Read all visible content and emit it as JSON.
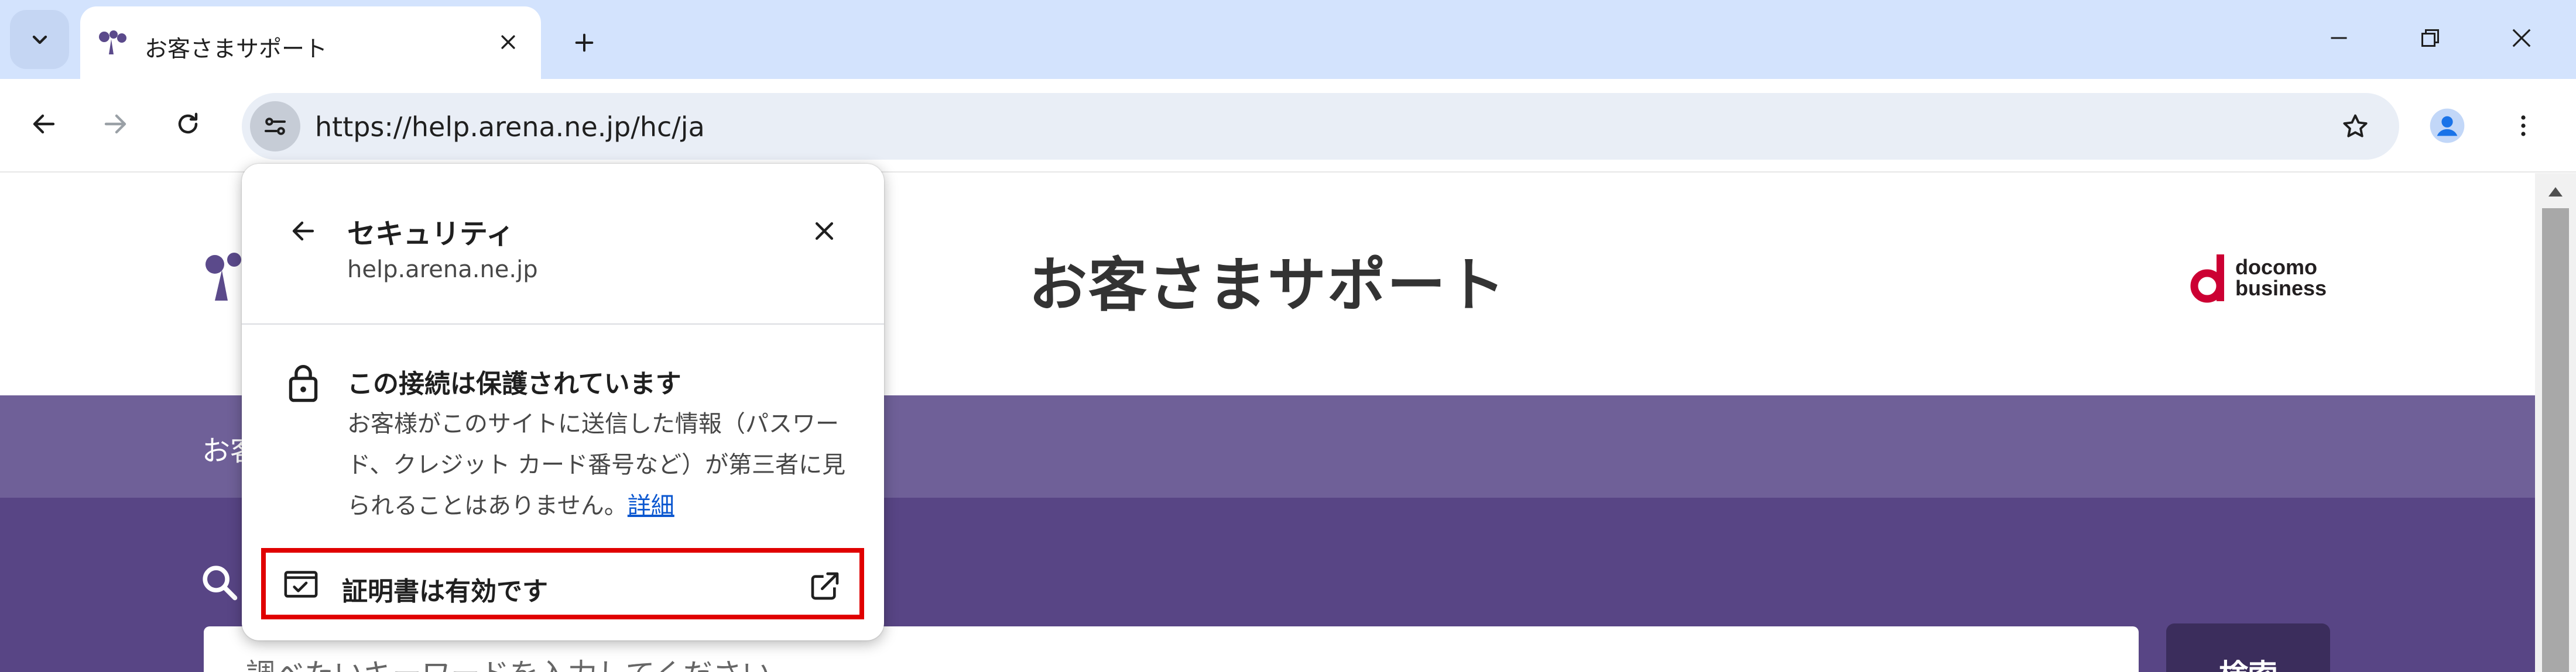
{
  "browser": {
    "tab": {
      "title": "お客さまサポート",
      "favicon": "arena-logo-icon"
    },
    "url": "https://help.arena.ne.jp/hc/ja",
    "icons": {
      "tab_search": "chevron-down-icon",
      "tab_close": "close-icon",
      "new_tab": "plus-icon",
      "back": "arrow-left-icon",
      "forward": "arrow-right-icon",
      "reload": "reload-icon",
      "site_info": "tune-icon",
      "bookmark": "star-icon",
      "profile": "person-icon",
      "menu": "more-vert-icon",
      "minimize": "minimize-icon",
      "restore": "restore-icon",
      "close": "close-icon"
    }
  },
  "page": {
    "title": "お客さまサポート",
    "logo_text_1": "docomo",
    "logo_text_2": "business",
    "nav_text": "お客",
    "search_placeholder": "調べたいキーワードを入力してください",
    "search_button": "検索",
    "colors": {
      "nav_band": "#6f6098",
      "hero": "#584585",
      "button": "#3b2d5c",
      "brand_red": "#cc0033"
    }
  },
  "popup": {
    "title": "セキュリティ",
    "host": "help.arena.ne.jp",
    "connection_title": "この接続は保護されています",
    "connection_desc": "お客様がこのサイトに送信した情報（パスワード、クレジット カード番号など）が第三者に見られることはありません。",
    "details_link": "詳細",
    "certificate_label": "証明書は有効です",
    "highlight_color": "#e00000"
  }
}
